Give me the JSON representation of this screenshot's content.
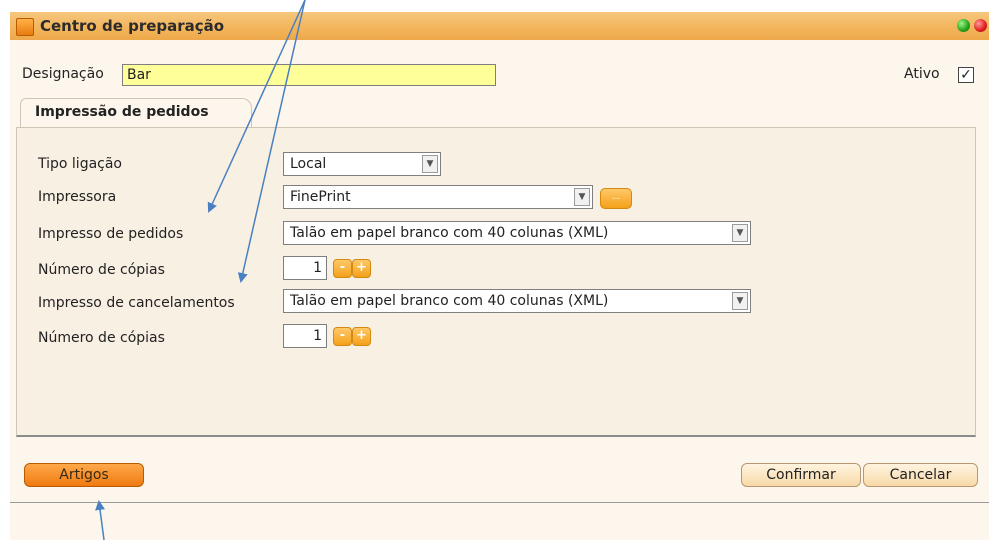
{
  "window": {
    "title": "Centro de preparação"
  },
  "form": {
    "designation_label": "Designação",
    "designation_value": "Bar",
    "active_label": "Ativo",
    "active_checked": true,
    "active_mark": "✓"
  },
  "tab": {
    "label": "Impressão de pedidos"
  },
  "panel": {
    "connection_type_label": "Tipo ligação",
    "connection_type_value": "Local",
    "printer_label": "Impressora",
    "printer_value": "FinePrint",
    "printer_browse_label": "...",
    "order_print_label": "Impresso de pedidos",
    "order_print_value": "Talão em papel branco com 40 colunas (XML)",
    "copies_label_1": "Número de cópias",
    "copies_value_1": "1",
    "cancel_print_label": "Impresso de cancelamentos",
    "cancel_print_value": "Talão em papel branco com 40 colunas (XML)",
    "copies_label_2": "Número de cópias",
    "copies_value_2": "1",
    "decrement_symbol": "-",
    "increment_symbol": "+",
    "dropdown_symbol": "▼"
  },
  "footer": {
    "articles_label": "Artigos",
    "confirm_label": "Confirmar",
    "cancel_label": "Cancelar"
  },
  "colors": {
    "titlebar": "#f2b45a",
    "accent_orange": "#f4a11a",
    "input_highlight": "#ffff99",
    "annotation_arrow": "#4a7fc1"
  },
  "icons": {
    "title": "folder-icon",
    "window_buttons": [
      "green-circle-icon",
      "red-circle-icon"
    ]
  }
}
